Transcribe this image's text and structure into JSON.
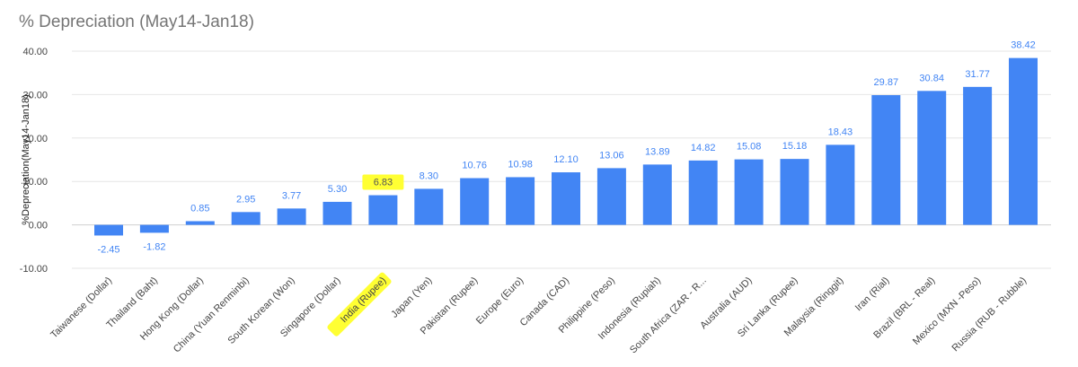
{
  "chart_data": {
    "type": "bar",
    "title": "% Depreciation (May14-Jan18)",
    "xlabel": "",
    "ylabel": "%Depreciation(May14-Jan18)",
    "categories": [
      "Taiwanese (Dollar)",
      "Thailand (Baht)",
      "Hong Kong (Dollar)",
      "China (Yuan Renminbi)",
      "South Korean (Won)",
      "Singapore (Dollar)",
      "India (Rupee)",
      "Japan (Yen)",
      "Pakistan (Rupee)",
      "Europe (Euro)",
      "Canada (CAD)",
      "Philippine (Peso)",
      "Indonesia (Rupiah)",
      "South Africa (ZAR - R...",
      "Australia (AUD)",
      "Sri Lanka (Rupee)",
      "Malaysia (Ringgit)",
      "Iran (Rial)",
      "Brazil (BRL - Real)",
      "Mexico (MXN -Peso)",
      "Russia (RUB - Rubble)"
    ],
    "values": [
      -2.45,
      -1.82,
      0.85,
      2.95,
      3.77,
      5.3,
      6.83,
      8.3,
      10.76,
      10.98,
      12.1,
      13.06,
      13.89,
      14.82,
      15.08,
      15.18,
      18.43,
      29.87,
      30.84,
      31.77,
      38.42
    ],
    "data_labels": [
      "-2.45",
      "-1.82",
      "0.85",
      "2.95",
      "3.77",
      "5.30",
      "6.83",
      "8.30",
      "10.76",
      "10.98",
      "12.10",
      "13.06",
      "13.89",
      "14.82",
      "15.08",
      "15.18",
      "18.43",
      "29.87",
      "30.84",
      "31.77",
      "38.42"
    ],
    "yticks": [
      "-10.00",
      "0.00",
      "10.00",
      "20.00",
      "30.00",
      "40.00"
    ],
    "ylim": [
      -10,
      40
    ],
    "grid": true,
    "legend": "none",
    "highlighted_category": "India (Rupee)",
    "colors": {
      "bar": "#4285f4",
      "label": "#4285f4",
      "highlight": "#ffff33",
      "grid": "#e6e6e6",
      "baseline": "#d0d0d0"
    }
  }
}
